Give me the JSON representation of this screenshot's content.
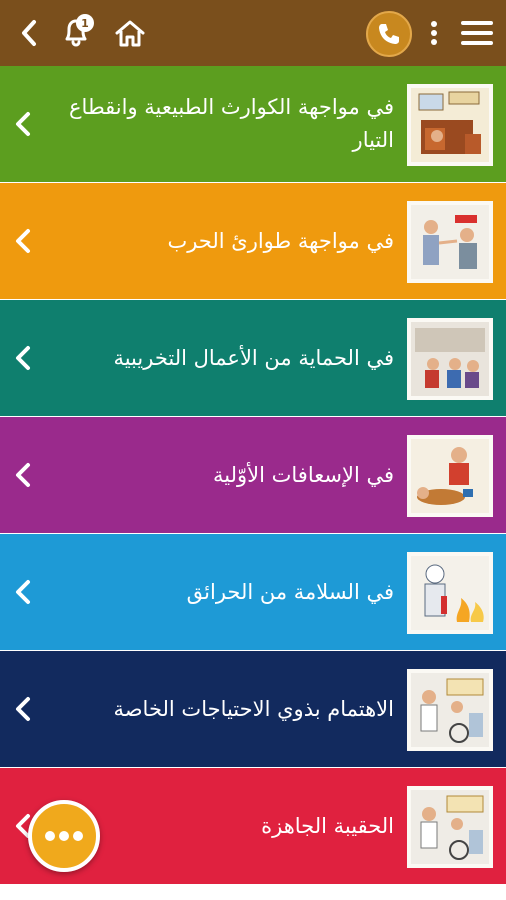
{
  "app": {
    "title": "",
    "colors": {
      "topbar": "#7a4f1c",
      "phone": "#c8881f",
      "fab": "#f0a91c"
    }
  },
  "header": {
    "back_icon": "chevron-left-icon",
    "bell_icon": "bell-icon",
    "notification_count": "1",
    "home_icon": "home-icon",
    "phone_icon": "phone-icon",
    "more_icon": "more-vertical-icon",
    "menu_icon": "hamburger-menu-icon"
  },
  "items": [
    {
      "label": "في مواجهة الكوارث الطبيعية وانقطاع التيار",
      "color": "#5c9e1f",
      "icon": "natural-disasters-illustration"
    },
    {
      "label": "في مواجهة طوارئ الحرب",
      "color": "#ef9a0e",
      "icon": "war-emergency-illustration"
    },
    {
      "label": "في الحماية من الأعمال التخريبية",
      "color": "#0f7f6e",
      "icon": "sabotage-protection-illustration"
    },
    {
      "label": "في الإسعافات الأوّلية",
      "color": "#9a2a8c",
      "icon": "first-aid-illustration"
    },
    {
      "label": "في السلامة من الحرائق",
      "color": "#1e9ad6",
      "icon": "fire-safety-illustration"
    },
    {
      "label": "الاهتمام بذوي الاحتياجات الخاصة",
      "color": "#122a5e",
      "icon": "special-needs-illustration"
    },
    {
      "label": "الحقيبة الجاهزة",
      "color": "#e0213f",
      "icon": "ready-bag-illustration"
    }
  ],
  "fab": {
    "icon": "ellipsis-icon"
  }
}
